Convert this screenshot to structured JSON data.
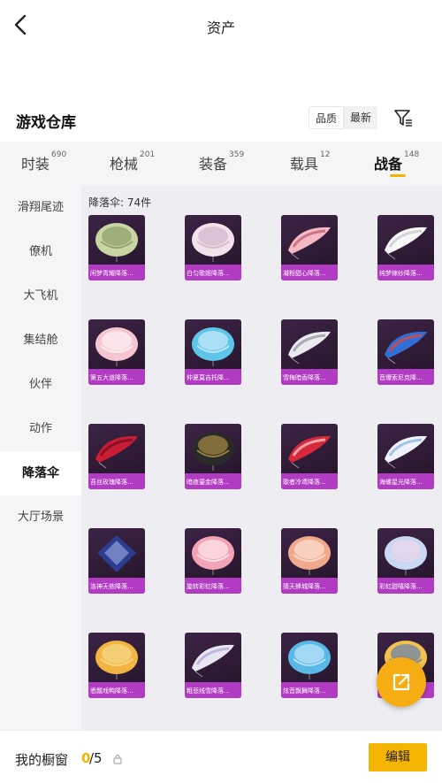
{
  "header": {
    "title": "资产",
    "back_icon": "chevron-left-icon"
  },
  "section": {
    "title": "游戏仓库",
    "sort_options": [
      "品质",
      "最新"
    ],
    "active_sort": "品质",
    "filter_icon": "filter-icon"
  },
  "tabs": [
    {
      "label": "时装",
      "count": "690"
    },
    {
      "label": "枪械",
      "count": "201"
    },
    {
      "label": "装备",
      "count": "359"
    },
    {
      "label": "载具",
      "count": "12"
    },
    {
      "label": "战备",
      "count": "148"
    }
  ],
  "active_tab": "战备",
  "sidebar": {
    "items": [
      "滑翔尾迹",
      "僚机",
      "大飞机",
      "集结舱",
      "伙伴",
      "动作",
      "降落伞",
      "大厅场景"
    ],
    "active": "降落伞"
  },
  "content": {
    "label": "降落伞: 74件",
    "items": [
      {
        "name": "闲梦青耀降落...",
        "shape": "dome",
        "colors": [
          "#c9d6a3",
          "#7a8f5a"
        ]
      },
      {
        "name": "白匀歌姬降落...",
        "shape": "dome",
        "colors": [
          "#f2e3ea",
          "#c9a7c4"
        ]
      },
      {
        "name": "凝粉甜心降落...",
        "shape": "wing",
        "colors": [
          "#f4b9c2",
          "#c2607a"
        ]
      },
      {
        "name": "纯梦嫁纱降落...",
        "shape": "wing",
        "colors": [
          "#f7f7f7",
          "#c9c9d2"
        ]
      },
      {
        "name": "第五大道降落...",
        "shape": "dome",
        "colors": [
          "#f5c6d2",
          "#ffffff"
        ]
      },
      {
        "name": "仲夏莫吉托降...",
        "shape": "dome",
        "colors": [
          "#5ec6e8",
          "#e9f4ff"
        ]
      },
      {
        "name": "雪梅暗香降落...",
        "shape": "wing",
        "colors": [
          "#e9e9ef",
          "#9b9ba8"
        ]
      },
      {
        "name": "音爆索尼克降...",
        "shape": "wing",
        "colors": [
          "#2f6fd6",
          "#e3463b"
        ]
      },
      {
        "name": "苔丝玫瑰降落...",
        "shape": "wing",
        "colors": [
          "#c81d35",
          "#7a0f1f"
        ]
      },
      {
        "name": "暗夜鎏金降落...",
        "shape": "dome",
        "colors": [
          "#2a2a2a",
          "#c9a54a"
        ]
      },
      {
        "name": "歌者冷鸢降落...",
        "shape": "wing",
        "colors": [
          "#d8283c",
          "#f2c2c2"
        ]
      },
      {
        "name": "海螺星光降落...",
        "shape": "wing",
        "colors": [
          "#eef3fb",
          "#8fb6e0"
        ]
      },
      {
        "name": "洛神天依降落...",
        "shape": "kite",
        "colors": [
          "#2c3d8f",
          "#c8d4ff"
        ]
      },
      {
        "name": "旋转彩虹降落...",
        "shape": "dome",
        "colors": [
          "#f3a3b6",
          "#ffffff"
        ]
      },
      {
        "name": "猜天蜂城降落...",
        "shape": "dome",
        "colors": [
          "#f1a98d",
          "#fff1e6"
        ]
      },
      {
        "name": "彩虹甜嘻降落...",
        "shape": "dome",
        "colors": [
          "#c9d7f2",
          "#f5d7ea"
        ]
      },
      {
        "name": "悉瓢戏鸭降落...",
        "shape": "dome",
        "colors": [
          "#f2b442",
          "#f8e2a0"
        ]
      },
      {
        "name": "粗悲线雪降落...",
        "shape": "wing",
        "colors": [
          "#e9e6f3",
          "#b6a9d8"
        ]
      },
      {
        "name": "炫音飘舞降落...",
        "shape": "dome",
        "colors": [
          "#59b9e6",
          "#dff2ff"
        ]
      },
      {
        "name": "",
        "shape": "dome",
        "colors": [
          "#f3c24a",
          "#3a6fd0"
        ]
      }
    ]
  },
  "fab": {
    "icon": "external-link-icon"
  },
  "bottom": {
    "label": "我的橱窗",
    "current": "0",
    "total": "/5",
    "lock_icon": "lock-icon",
    "edit_label": "编辑"
  }
}
